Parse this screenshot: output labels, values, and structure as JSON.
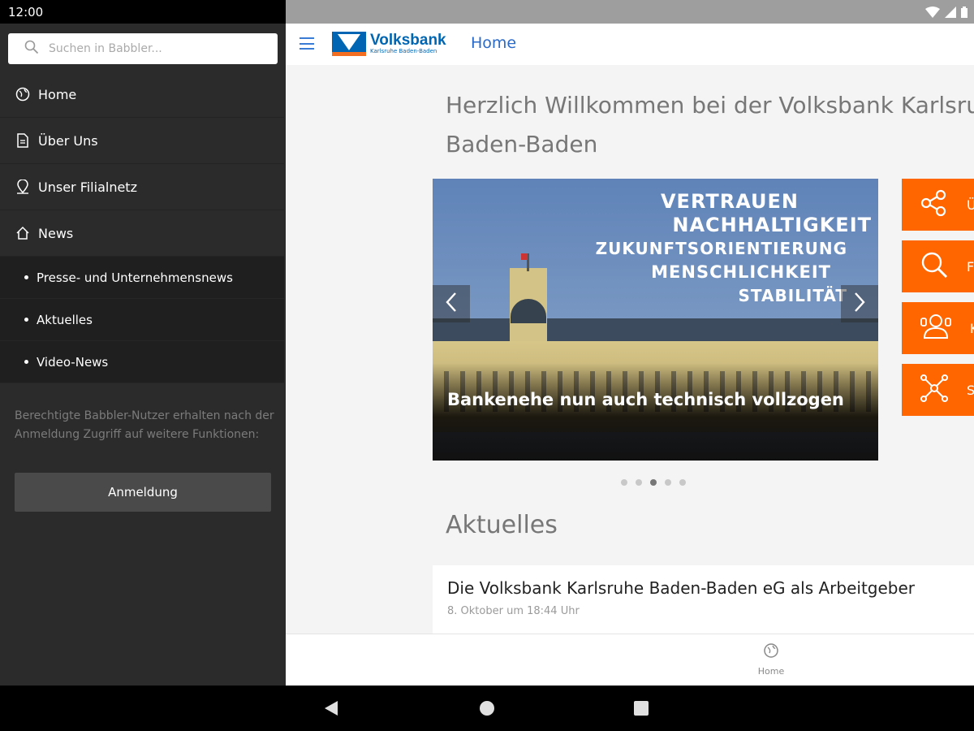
{
  "status": {
    "time": "12:00"
  },
  "search": {
    "placeholder": "Suchen in Babbler..."
  },
  "nav": {
    "items": [
      {
        "label": "Home",
        "icon": "globe-icon"
      },
      {
        "label": "Über Uns",
        "icon": "document-icon"
      },
      {
        "label": "Unser Filialnetz",
        "icon": "map-pin-icon"
      },
      {
        "label": "News",
        "icon": "house-icon"
      }
    ],
    "subitems": [
      {
        "label": "Presse- und Unternehmensnews"
      },
      {
        "label": "Aktuelles"
      },
      {
        "label": "Video-News"
      }
    ]
  },
  "login": {
    "info": "Berechtigte Babbler-Nutzer erhalten nach der Anmeldung Zugriff auf weitere Funktionen:",
    "button_label": "Anmeldung"
  },
  "appbar": {
    "logo_title": "Volksbank",
    "logo_subtitle": "Karlsruhe Baden-Baden",
    "title": "Home"
  },
  "welcome": {
    "line1": "Herzlich Willkommen bei der Volksbank Karlsruhe",
    "line2": "Baden-Baden"
  },
  "carousel": {
    "image_words": [
      "VERTRAUEN",
      "NACHHALTIGKEIT",
      "ZUKUNFTSORIENTIERUNG",
      "MENSCHLICHKEIT",
      "STABILITÄT"
    ],
    "caption": "Bankenehe nun auch technisch vollzogen",
    "dot_count": 5,
    "active_index": 2
  },
  "quick_links": [
    {
      "label": "Ü",
      "icon": "share-icon"
    },
    {
      "label": "F",
      "icon": "search-icon"
    },
    {
      "label": "K",
      "icon": "contact-icon"
    },
    {
      "label": "S",
      "icon": "network-icon"
    }
  ],
  "section": {
    "title": "Aktuelles"
  },
  "news": [
    {
      "title": "Die Volksbank Karlsruhe Baden-Baden eG als Arbeitgeber",
      "date": "8. Oktober um 18:44 Uhr"
    }
  ],
  "bottom_tab": {
    "label": "Home"
  },
  "colors": {
    "accent_orange": "#ff6600",
    "brand_blue": "#0066b3",
    "link_blue": "#2a6ac8"
  }
}
